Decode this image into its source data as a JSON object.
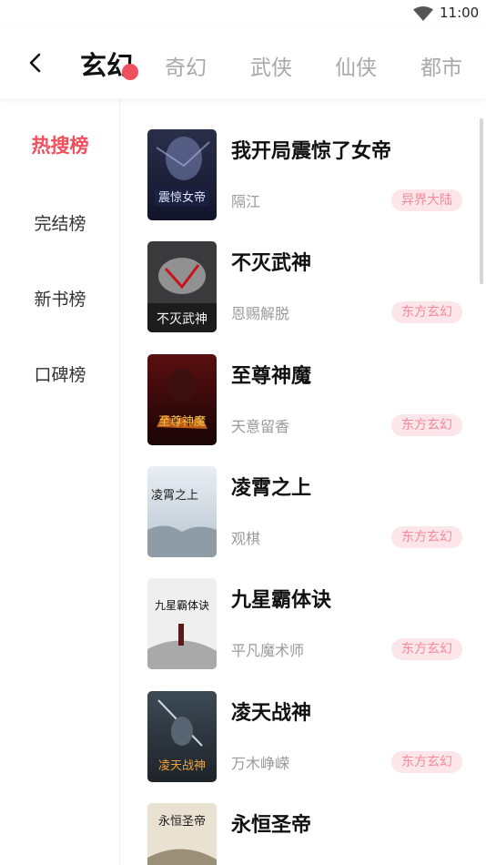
{
  "status_bar": {
    "time": "11:00",
    "wifi_icon": "wifi-icon"
  },
  "header": {
    "back_icon": "chevron-left-icon",
    "tabs": [
      {
        "label": "玄幻",
        "active": true
      },
      {
        "label": "奇幻",
        "active": false
      },
      {
        "label": "武侠",
        "active": false
      },
      {
        "label": "仙侠",
        "active": false
      },
      {
        "label": "都市",
        "active": false
      }
    ]
  },
  "sidebar": {
    "items": [
      {
        "label": "热搜榜",
        "active": true
      },
      {
        "label": "完结榜",
        "active": false
      },
      {
        "label": "新书榜",
        "active": false
      },
      {
        "label": "口碑榜",
        "active": false
      }
    ]
  },
  "books": [
    {
      "title": "我开局震惊了女帝",
      "author": "隔江",
      "tag": "异界大陆",
      "cover_text": "震惊女帝"
    },
    {
      "title": "不灭武神",
      "author": "恩赐解脱",
      "tag": "东方玄幻",
      "cover_text": "不灭武神"
    },
    {
      "title": "至尊神魔",
      "author": "天意留香",
      "tag": "东方玄幻",
      "cover_text": "至尊神魔"
    },
    {
      "title": "凌霄之上",
      "author": "观棋",
      "tag": "东方玄幻",
      "cover_text": "凌霄之上"
    },
    {
      "title": "九星霸体诀",
      "author": "平凡魔术师",
      "tag": "东方玄幻",
      "cover_text": "九星霸体诀"
    },
    {
      "title": "凌天战神",
      "author": "万木峥嵘",
      "tag": "东方玄幻",
      "cover_text": "凌天战神"
    },
    {
      "title": "永恒圣帝",
      "author": "",
      "tag": "",
      "cover_text": "永恒圣帝"
    }
  ],
  "colors": {
    "accent": "#f0505d",
    "tag_bg": "#fde6ea",
    "tag_text": "#f58a9b"
  }
}
